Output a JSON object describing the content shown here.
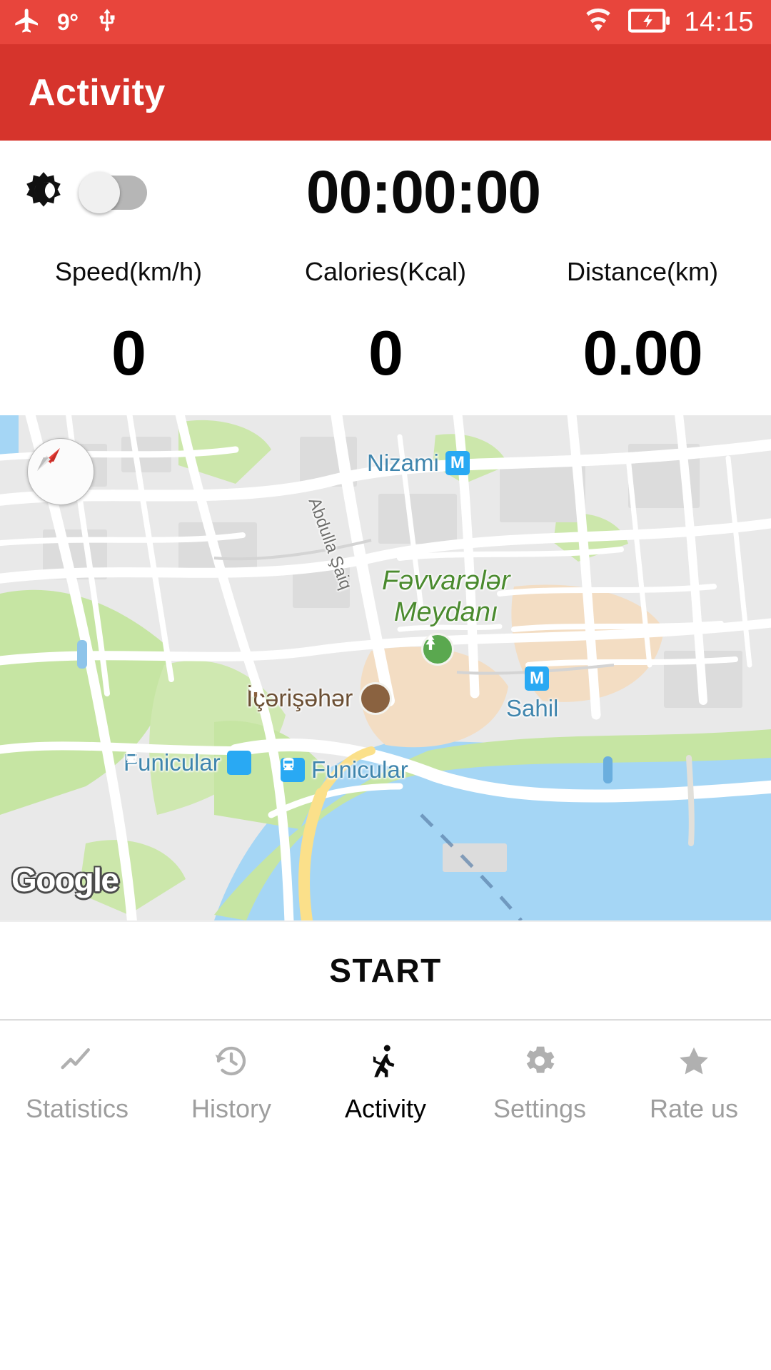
{
  "status_bar": {
    "airplane_icon": "airplane-icon",
    "temperature": "9°",
    "usb_icon": "usb-icon",
    "wifi_icon": "wifi-icon",
    "battery_icon": "battery-charging-icon",
    "clock": "14:15",
    "background_color": "#e8453c",
    "text_color": "#ffffff"
  },
  "app_bar": {
    "title": "Activity",
    "background_color": "#d6342c"
  },
  "timer_panel": {
    "theme_icon": "brightness-moon-icon",
    "toggle": {
      "name": "dark-mode-toggle",
      "state": "off"
    },
    "elapsed_time": "00:00:00"
  },
  "stats": [
    {
      "label": "Speed(km/h)",
      "value": "0"
    },
    {
      "label": "Calories(Kcal)",
      "value": "0"
    },
    {
      "label": "Distance(km)",
      "value": "0.00"
    }
  ],
  "map": {
    "provider_watermark": "Google",
    "compass_icon": "compass-needle-icon",
    "labels": [
      {
        "text": "Nizami",
        "badge": "metro-m-badge",
        "kind": "transit"
      },
      {
        "text": "Fəvvarələr",
        "text2": "Meydanı",
        "kind": "park"
      },
      {
        "text": "İçərişəhər",
        "badge": "castle-badge",
        "kind": "historic"
      },
      {
        "text": "Sahil",
        "badge": "metro-m-badge",
        "kind": "transit"
      },
      {
        "text": "Funicular",
        "badge": "rail-badge",
        "kind": "transit"
      },
      {
        "text": "Funicular",
        "badge": "rail-badge",
        "kind": "transit"
      },
      {
        "text": "Abdulla Şaiq",
        "kind": "street"
      }
    ],
    "colors": {
      "water": "#a5d6f5",
      "park": "#c6e5a3",
      "land": "#e9e9e9",
      "road": "#ffffff",
      "highway": "#fbe08a",
      "building_area": "#f3ddc3"
    }
  },
  "start_button": {
    "label": "START"
  },
  "bottom_nav": {
    "active_index": 2,
    "items": [
      {
        "label": "Statistics",
        "icon": "line-chart-icon"
      },
      {
        "label": "History",
        "icon": "clock-restore-icon"
      },
      {
        "label": "Activity",
        "icon": "walking-person-icon"
      },
      {
        "label": "Settings",
        "icon": "gear-icon"
      },
      {
        "label": "Rate us",
        "icon": "star-icon"
      }
    ]
  }
}
